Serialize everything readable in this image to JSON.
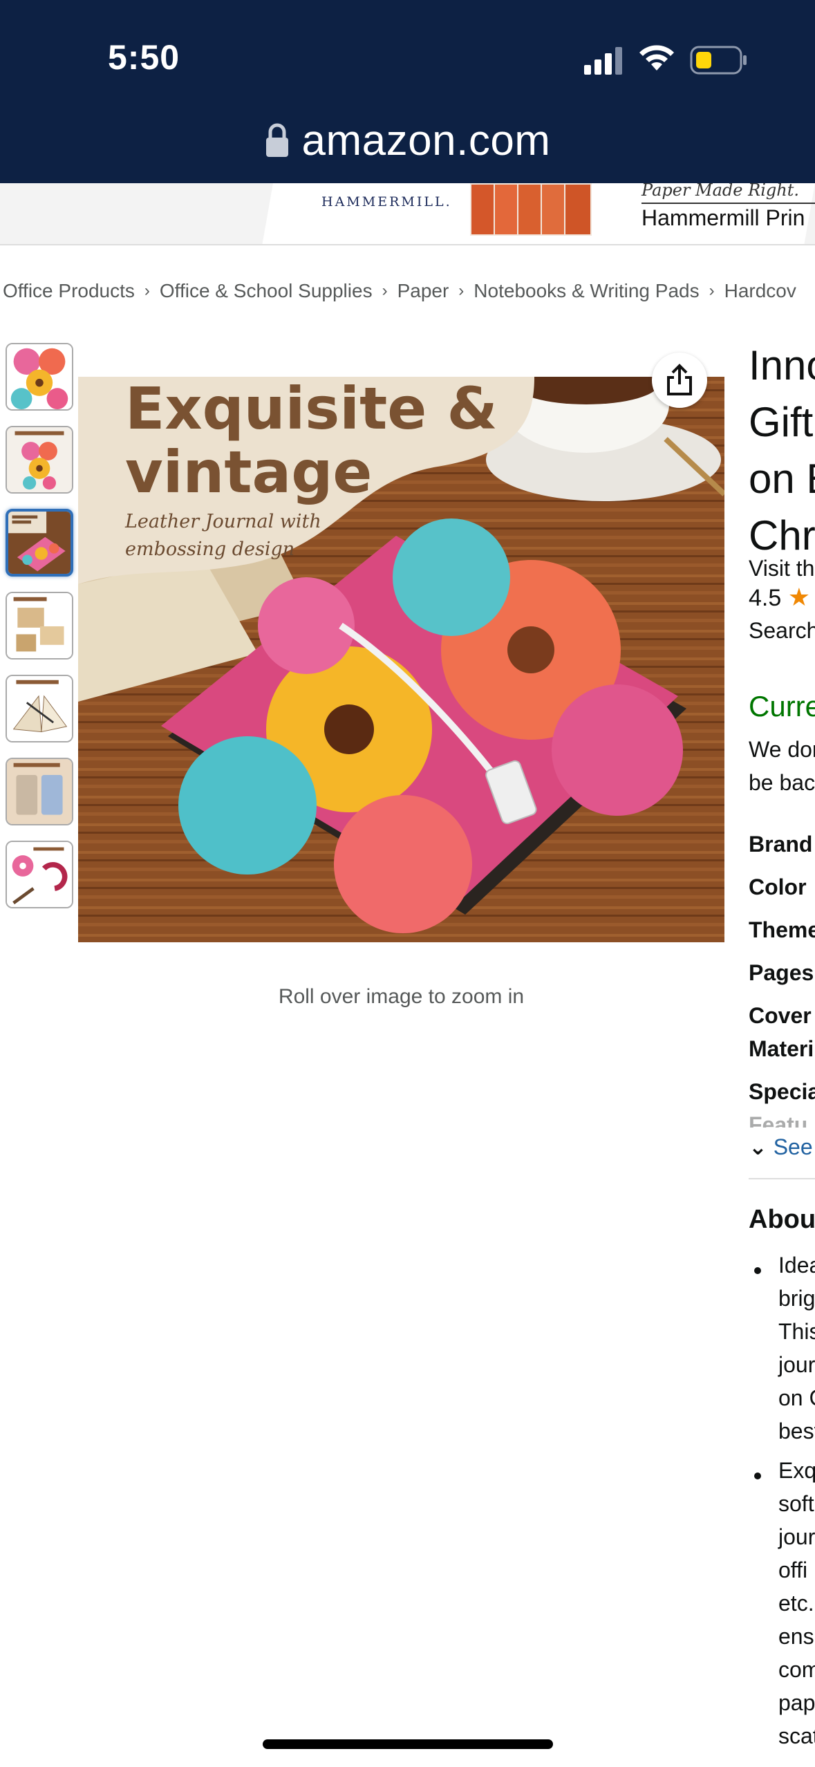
{
  "status_bar": {
    "time": "5:50"
  },
  "browser": {
    "url": "amazon.com"
  },
  "banner": {
    "logo": "HAMMERMILL.",
    "tagline": "Paper Made Right.",
    "title": "Hammermill Prin"
  },
  "breadcrumb": [
    "Office Products",
    "Office & School Supplies",
    "Paper",
    "Notebooks & Writing Pads",
    "Hardcov"
  ],
  "thumbnails": [
    {
      "caption": ""
    },
    {
      "caption": "PORTABLE SIZE"
    },
    {
      "caption": "Exquisite & vintage"
    },
    {
      "caption": "REFILLABLE"
    },
    {
      "caption": "SMOOTH TO WRITE"
    },
    {
      "caption": "MULTIFUNCTIONAL"
    },
    {
      "caption": ""
    }
  ],
  "main_image": {
    "headline_1": "Exquisite &",
    "headline_2": "vintage",
    "sub_1": "Leather Journal with",
    "sub_2": "embossing design",
    "zoom_hint": "Roll over image to zoom in"
  },
  "product": {
    "title_lines": [
      "Inno",
      "Gift",
      "on E",
      "Chri"
    ],
    "store_link": "Visit th",
    "rating": "4.5",
    "search_link": "Search",
    "availability": "Curre",
    "availability_note_1": "We dor",
    "availability_note_2": "be back",
    "specs": [
      "Brand",
      "Color",
      "Theme",
      "Pages",
      "Cover",
      "Materi",
      "Specia",
      "Featu"
    ],
    "see_more": "See",
    "about_heading": "Abou",
    "bullet_1_lines": [
      "Idea",
      "brig",
      "This",
      "jour",
      "on C",
      "best"
    ],
    "bullet_2_lines": [
      "Exq",
      "soft",
      "jour",
      "offi",
      "etc.",
      "ensu",
      "com",
      "pap",
      "scat"
    ]
  },
  "colors": {
    "topbar": "#0d2144",
    "link": "#2162a1",
    "availability": "#007600",
    "star": "#f08804",
    "selected_thumb_border": "#2f6fb8"
  }
}
